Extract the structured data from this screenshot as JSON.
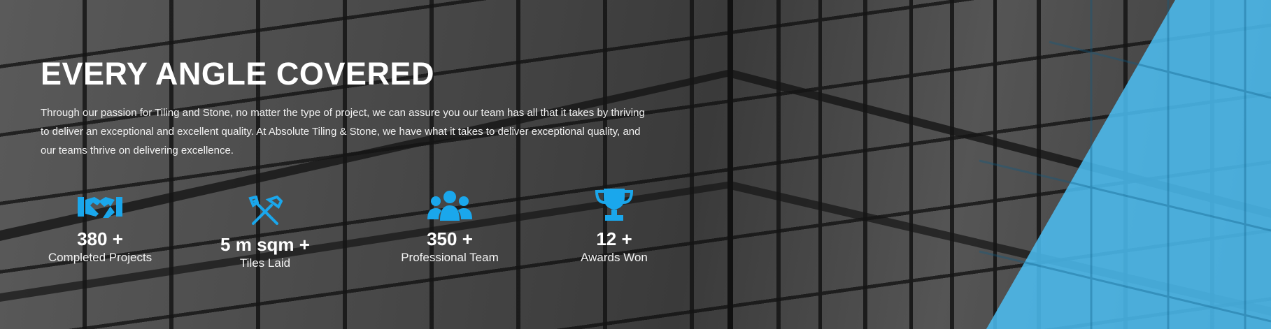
{
  "hero": {
    "title": "EVERY ANGLE COVERED",
    "description": "Through our passion for Tiling and Stone, no matter the type of project, we can assure you our team has all that it takes by thriving to deliver an exceptional and excellent quality. At Absolute Tiling & Stone, we have what it takes to deliver exceptional quality, and our teams thrive on delivering excellence."
  },
  "stats": [
    {
      "icon": "handshake-icon",
      "value": "380 +",
      "label": "Completed Projects"
    },
    {
      "icon": "tools-icon",
      "value": "5 m sqm +",
      "label": "Tiles Laid"
    },
    {
      "icon": "team-icon",
      "value": "350 +",
      "label": "Professional Team"
    },
    {
      "icon": "trophy-icon",
      "value": "12 +",
      "label": "Awards Won"
    }
  ],
  "colors": {
    "accent": "#1aa7ec",
    "overlay_accent": "#4cc0f5",
    "text": "#ffffff"
  }
}
